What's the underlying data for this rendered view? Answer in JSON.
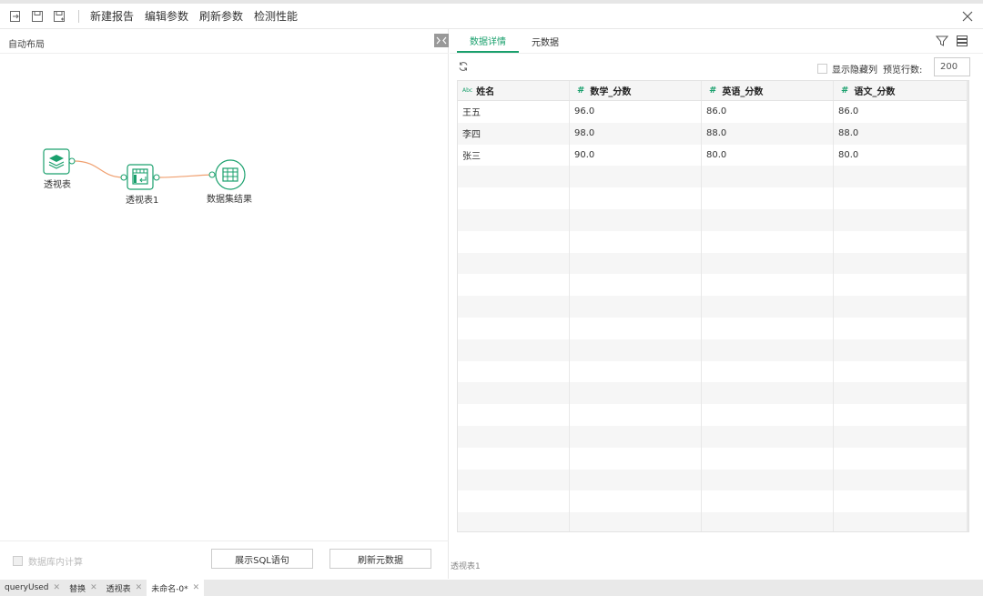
{
  "toolbar": {
    "new_report": "新建报告",
    "edit_params": "编辑参数",
    "refresh_params": "刷新参数",
    "check_performance": "检测性能"
  },
  "left": {
    "auto_layout": "自动布局",
    "nodes": [
      {
        "label": "透视表",
        "icon": "layers-icon"
      },
      {
        "label": "透视表1",
        "icon": "pivot-icon"
      },
      {
        "label": "数据集结果",
        "icon": "table-icon"
      }
    ],
    "db_compute": "数据库内计算",
    "show_sql": "展示SQL语句",
    "refresh_meta": "刷新元数据"
  },
  "right": {
    "tabs": [
      "数据详情",
      "元数据"
    ],
    "show_hidden": "显示隐藏列",
    "preview_rows_label": "预览行数:",
    "preview_rows_value": "200",
    "columns": [
      {
        "type": "Abc",
        "name": "姓名"
      },
      {
        "type": "#",
        "name": "数学_分数"
      },
      {
        "type": "#",
        "name": "英语_分数"
      },
      {
        "type": "#",
        "name": "语文_分数"
      }
    ],
    "rows": [
      [
        "王五",
        "96.0",
        "86.0",
        "86.0"
      ],
      [
        "李四",
        "98.0",
        "88.0",
        "88.0"
      ],
      [
        "张三",
        "90.0",
        "80.0",
        "80.0"
      ]
    ],
    "footer_node": "透视表1"
  },
  "bottom_tabs": [
    {
      "label": "queryUsed",
      "active": false
    },
    {
      "label": "替换",
      "active": false
    },
    {
      "label": "透视表",
      "active": false
    },
    {
      "label": "未命名-0*",
      "active": true
    }
  ],
  "colors": {
    "accent": "#1aa06d",
    "edge": "#f0a070"
  }
}
